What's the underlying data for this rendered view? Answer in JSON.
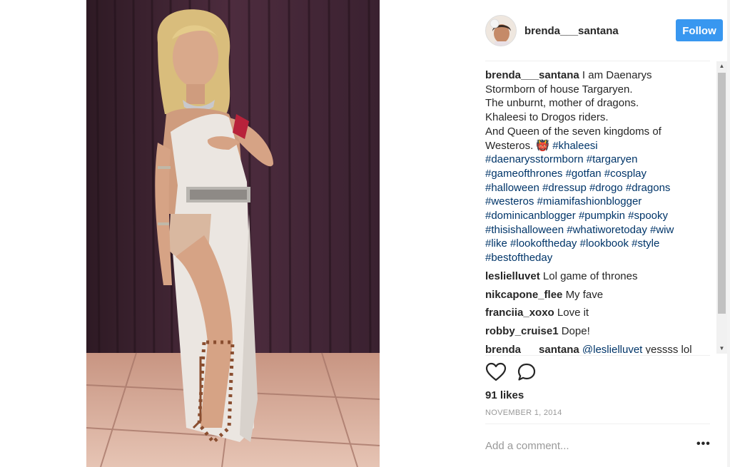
{
  "post": {
    "username": "brenda___santana",
    "follow_label": "Follow",
    "caption_lines": [
      "I am Daenarys",
      "Stormborn of house Targaryen.",
      "The unburnt, mother of dragons.",
      "Khaleesi to Drogos riders.",
      "And Queen of the seven kingdoms of",
      "Westeros. 👹"
    ],
    "hashtags": [
      "#khaleesi",
      "#daenarysstormborn",
      "#targaryen",
      "#gameofthrones",
      "#gotfan",
      "#cosplay",
      "#halloween",
      "#dressup",
      "#drogo",
      "#dragons",
      "#westeros",
      "#miamifashionblogger",
      "#dominicanblogger",
      "#pumpkin",
      "#spooky",
      "#thisishalloween",
      "#whatiworetoday",
      "#wiw",
      "#like",
      "#lookoftheday",
      "#lookbook",
      "#style",
      "#bestoftheday"
    ],
    "comments": [
      {
        "user": "leslielluvet",
        "text": "Lol game of thrones"
      },
      {
        "user": "nikcapone_flee",
        "text": "My fave"
      },
      {
        "user": "franciia_xoxo",
        "text": "Love it"
      },
      {
        "user": "robby_cruise1",
        "text": "Dope!"
      },
      {
        "user": "brenda___santana",
        "mention": "@leslielluvet",
        "text": "yessss lol"
      }
    ],
    "likes": "91 likes",
    "date": "NOVEMBER 1, 2014",
    "add_comment_placeholder": "Add a comment...",
    "more_label": "•••"
  },
  "icons": {
    "like": "heart-icon",
    "comment": "comment-icon"
  },
  "colors": {
    "follow_button": "#3897f0",
    "hashtag": "#003569",
    "muted": "#999999"
  }
}
